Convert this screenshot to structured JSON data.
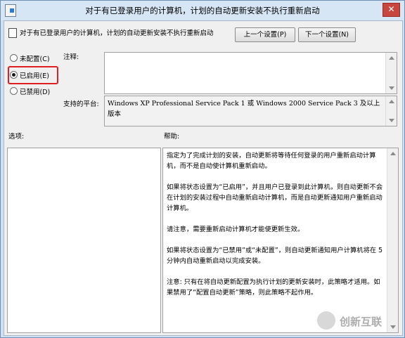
{
  "window": {
    "title": "对于有已登录用户的计算机，计划的自动更新安装不执行重新启动",
    "close_glyph": "✕"
  },
  "header": {
    "policy_name": "对于有已登录用户的计算机，计划的自动更新安装不执行重新启动",
    "prev_button": "上一个设置(P)",
    "next_button": "下一个设置(N)"
  },
  "state": {
    "options": [
      {
        "label": "未配置(C)",
        "checked": false
      },
      {
        "label": "已启用(E)",
        "checked": true
      },
      {
        "label": "已禁用(D)",
        "checked": false
      }
    ],
    "highlight_color": "#e02020"
  },
  "comment": {
    "label": "注释:",
    "value": ""
  },
  "supported": {
    "label": "支持的平台:",
    "value": "Windows XP Professional Service Pack 1 或 Windows 2000 Service Pack 3 及以上版本"
  },
  "options_panel": {
    "label": "选项:"
  },
  "help": {
    "label": "帮助:",
    "paragraphs": [
      "指定为了完成计划的安装，自动更新将等待任何登录的用户重新启动计算机，而不是自动使计算机重新启动。",
      "如果将状态设置为“已启用”，并且用户已登录到此计算机，则自动更新不会在计划的安装过程中自动重新启动计算机，而是自动更新通知用户重新启动计算机。",
      "请注意，需要重新启动计算机才能使更新生效。",
      "如果将状态设置为“已禁用”或“未配置”，则自动更新通知用户计算机将在 5 分钟内自动重新启动以完成安装。",
      "注意: 只有在将自动更新配置为执行计划的更新安装时，此策略才适用。如果禁用了“配置自动更新”策略，则此策略不起作用。"
    ]
  },
  "watermark": {
    "text": "创新互联"
  }
}
